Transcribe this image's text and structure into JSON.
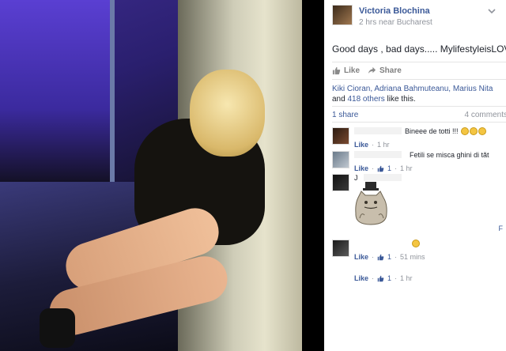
{
  "post": {
    "author": "Victoria Blochina",
    "meta": "2 hrs near Bucharest",
    "text": "Good days , bad days..... MylifestyleisLOVE",
    "like_label": "Like",
    "share_label": "Share",
    "likers_names": "Kiki Cioran, Adriana Bahmuteanu, Marius Nita",
    "likers_and": " and ",
    "likers_others": "418 others",
    "likers_suffix": " like this.",
    "shares": "1 share",
    "comment_count": "4 comments"
  },
  "comments": [
    {
      "text": "Bineee de totti !!!",
      "like": "Like",
      "dot": "·",
      "likes": "",
      "time": "1 hr",
      "emoji_count": 3
    },
    {
      "text": "Fetili se misca ghini di tăt",
      "like": "Like",
      "dot": "·",
      "likes": "1",
      "time": "1 hr",
      "emoji_count": 0
    },
    {
      "text": "J",
      "like": "Like",
      "dot": "·",
      "likes": "1",
      "time": "1 hr",
      "emoji_count": 0
    },
    {
      "text": "",
      "like": "Like",
      "dot": "·",
      "likes": "1",
      "time": "51 mins",
      "emoji_count": 1
    }
  ],
  "edge_mark": "F",
  "colors": {
    "link": "#3b5998",
    "muted": "#90949c",
    "heart": "#f3a6b5"
  },
  "icons": {
    "like": "thumbs-up-icon",
    "share": "share-arrow-icon",
    "options": "chevron-down-icon"
  }
}
